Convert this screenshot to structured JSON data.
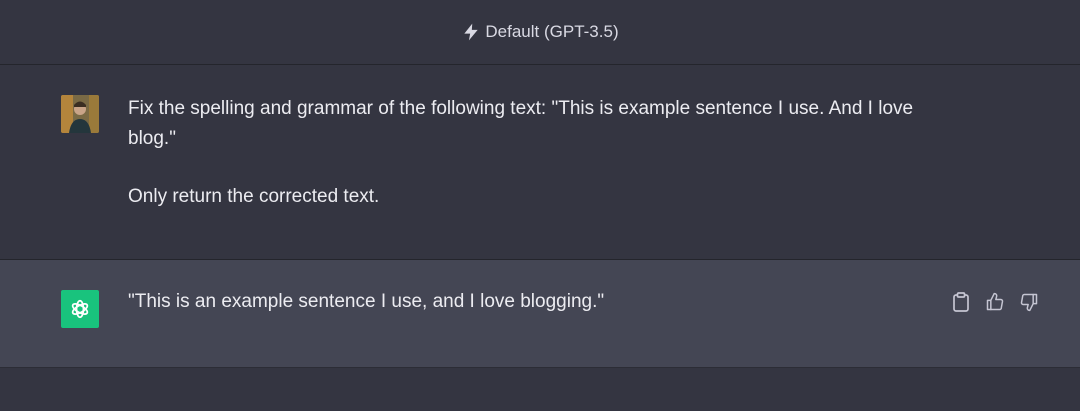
{
  "header": {
    "model_label": "Default (GPT-3.5)",
    "icon": "lightning-bolt-icon"
  },
  "conversation": {
    "user_message": {
      "avatar": "user-photo-avatar",
      "paragraphs": [
        "Fix the spelling and grammar of the following text: \"This is example sentence I use. And I love blog.\"",
        "Only return the corrected text."
      ]
    },
    "assistant_message": {
      "avatar": "openai-logo-icon",
      "text": "\"This is an example sentence I use, and I love blogging.\"",
      "actions": [
        "clipboard-icon",
        "thumbs-up-icon",
        "thumbs-down-icon"
      ]
    }
  },
  "colors": {
    "background": "#343541",
    "assistant_background": "#444654",
    "text": "#ececf1",
    "accent": "#19c37d",
    "icon": "#c5c5d2"
  }
}
